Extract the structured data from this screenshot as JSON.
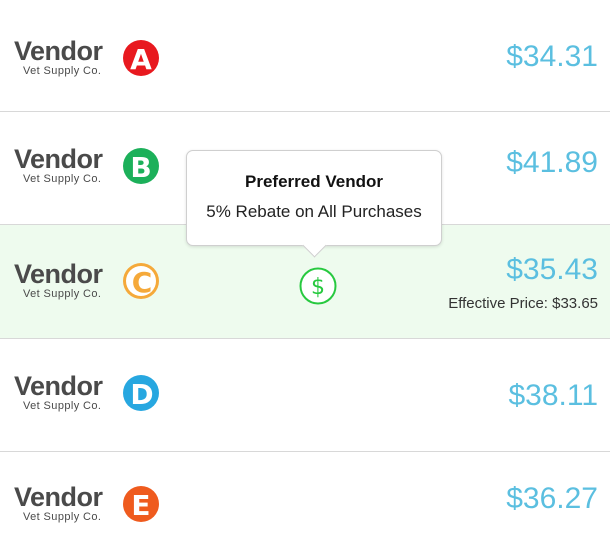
{
  "vendors": [
    {
      "word": "Vendor",
      "subtitle": "Vet Supply Co.",
      "letter": "A",
      "color": "#e8191f",
      "price": "$34.31"
    },
    {
      "word": "Vendor",
      "subtitle": "Vet Supply Co.",
      "letter": "B",
      "color": "#1cb05a",
      "price": "$41.89"
    },
    {
      "word": "Vendor",
      "subtitle": "Vet Supply Co.",
      "letter": "C",
      "color": "#f5a93a",
      "price": "$35.43",
      "effective_price": "Effective Price: $33.65",
      "highlighted": true
    },
    {
      "word": "Vendor",
      "subtitle": "Vet Supply Co.",
      "letter": "D",
      "color": "#27a7e0",
      "price": "$38.11"
    },
    {
      "word": "Vendor",
      "subtitle": "Vet Supply Co.",
      "letter": "E",
      "color": "#ef5b1e",
      "price": "$36.27"
    }
  ],
  "tooltip": {
    "title": "Preferred Vendor",
    "body": "5% Rebate on All Purchases"
  },
  "icons": {
    "preferred": "dollar-circle-icon"
  },
  "colors": {
    "price": "#5bbfe0",
    "highlight_bg": "#eefbee",
    "dollar_icon": "#27c93f"
  }
}
